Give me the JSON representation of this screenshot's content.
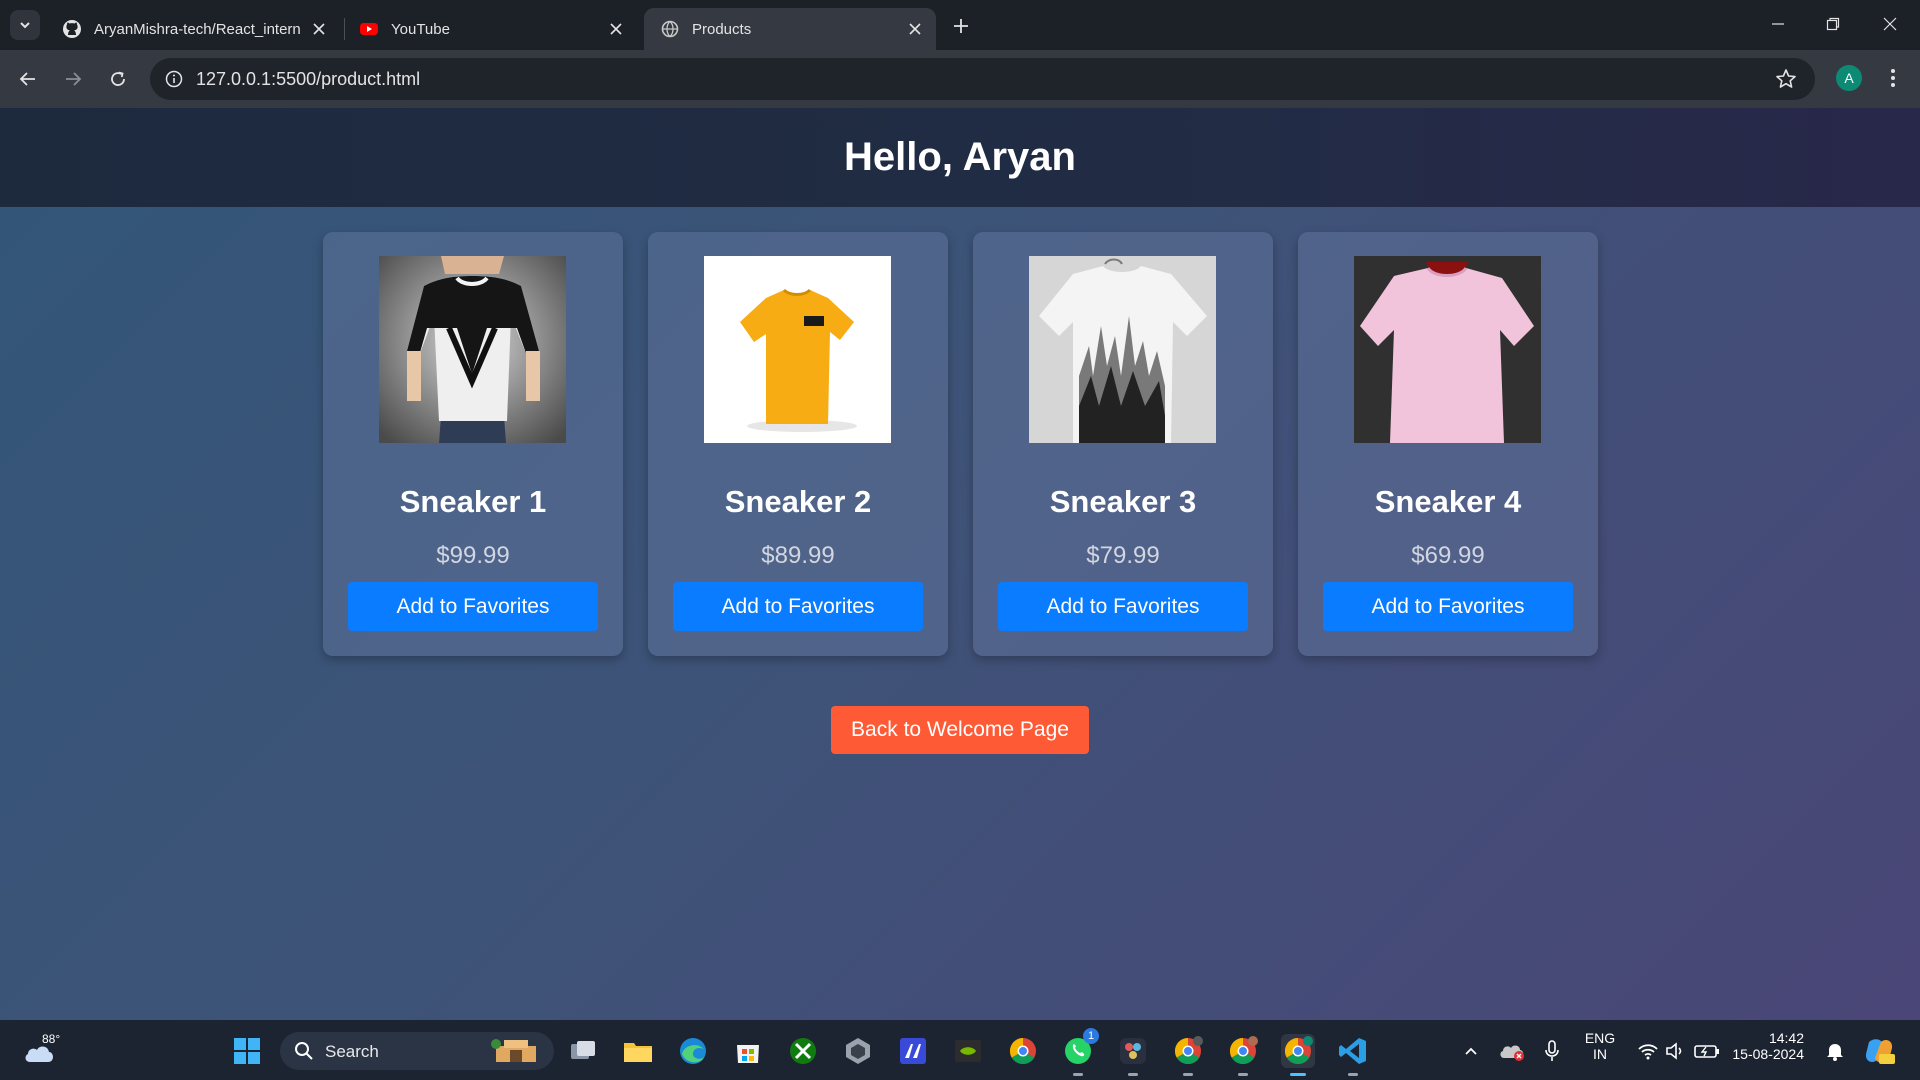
{
  "browser": {
    "tabs": [
      {
        "title": "AryanMishra-tech/React_intern",
        "icon": "github-icon"
      },
      {
        "title": "YouTube",
        "icon": "youtube-icon"
      },
      {
        "title": "Products",
        "icon": "globe-icon",
        "active": true
      }
    ],
    "url": "127.0.0.1:5500/product.html",
    "profile_initial": "A"
  },
  "page": {
    "greeting": "Hello, Aryan",
    "products": [
      {
        "name": "Sneaker 1",
        "price": "$99.99",
        "button": "Add to Favorites",
        "image": "black-white-v-tshirt"
      },
      {
        "name": "Sneaker 2",
        "price": "$89.99",
        "button": "Add to Favorites",
        "image": "yellow-tshirt"
      },
      {
        "name": "Sneaker 3",
        "price": "$79.99",
        "button": "Add to Favorites",
        "image": "white-forest-print-tshirt"
      },
      {
        "name": "Sneaker 4",
        "price": "$69.99",
        "button": "Add to Favorites",
        "image": "pink-tshirt"
      }
    ],
    "back_button": "Back to Welcome Page",
    "colors": {
      "primary_button": "#0a7cff",
      "back_button": "#ff5a36"
    }
  },
  "taskbar": {
    "weather_temp": "88°",
    "search_label": "Search",
    "whatsapp_badge": "1",
    "language_top": "ENG",
    "language_bottom": "IN",
    "time": "14:42",
    "date": "15-08-2024"
  }
}
